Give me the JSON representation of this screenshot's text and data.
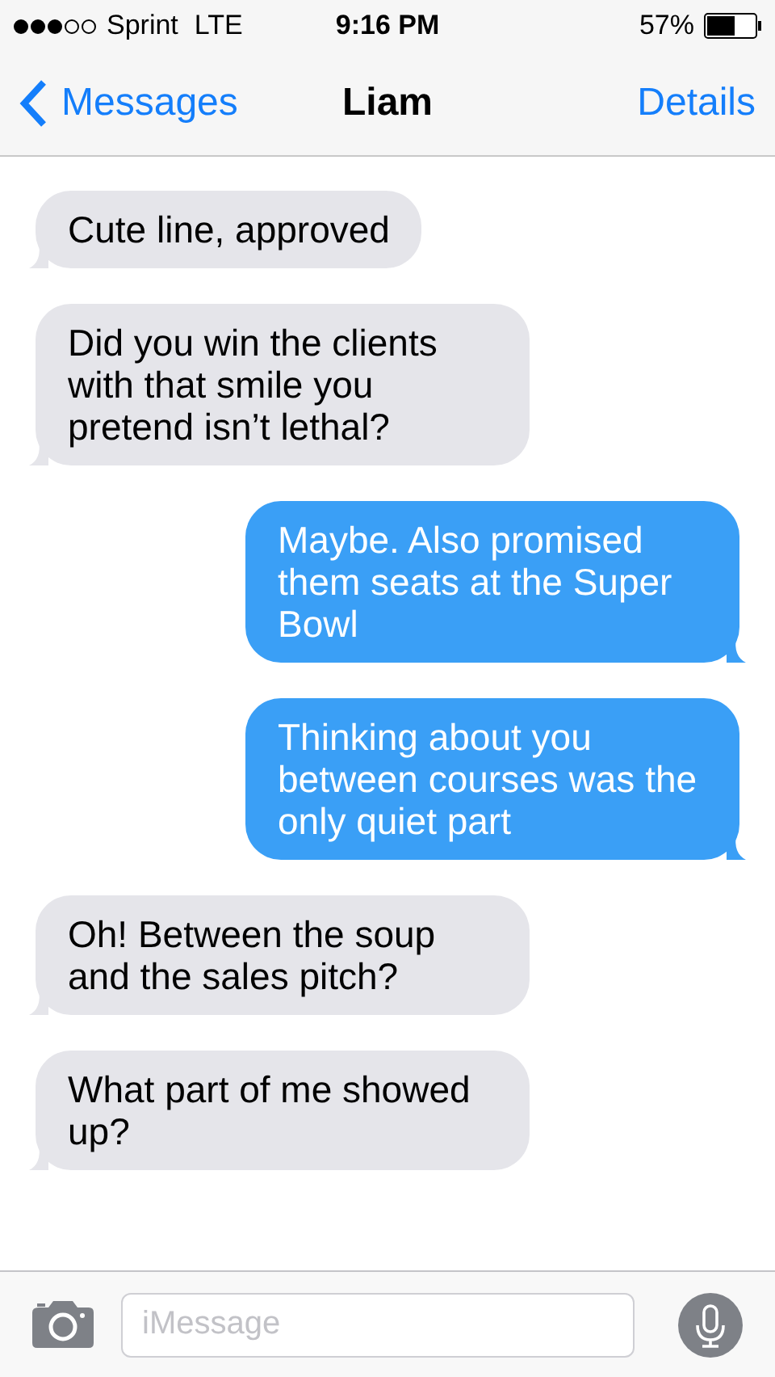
{
  "status_bar": {
    "carrier": "Sprint",
    "network": "LTE",
    "time": "9:16 PM",
    "battery": "57%"
  },
  "nav": {
    "back": "Messages",
    "title": "Liam",
    "action": "Details"
  },
  "messages": [
    {
      "kind": "received",
      "text": "Cute line, approved"
    },
    {
      "kind": "received",
      "text": "Did you win the clients with that smile you pretend isn’t lethal?"
    },
    {
      "kind": "sent",
      "text": "Maybe. Also promised them seats at the Super Bowl"
    },
    {
      "kind": "sent",
      "text": "Thinking about you between courses was the only quiet part"
    },
    {
      "kind": "received",
      "text": "Oh! Between the soup and the sales pitch?"
    },
    {
      "kind": "received",
      "text": "What part of me showed up?"
    }
  ],
  "composer": {
    "placeholder": "iMessage"
  }
}
